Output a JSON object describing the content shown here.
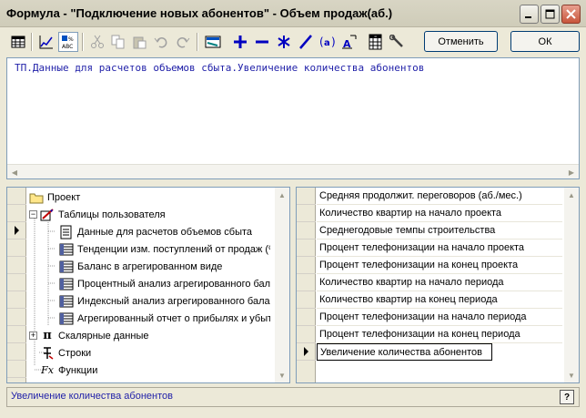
{
  "window": {
    "title": "Формула - \"Подключение новых абонентов\" - Объем продаж(аб.)"
  },
  "toolbar": {
    "cancel_label": "Отменить",
    "ok_label": "ОК",
    "icons": [
      "table-icon",
      "chart-icon",
      "scale-icon",
      "cut-icon",
      "copy-icon",
      "paste-icon",
      "undo-icon",
      "redo-icon",
      "screen-icon",
      "plus-icon",
      "minus-icon",
      "asterisk-icon",
      "slash-icon",
      "a-paren-icon",
      "a-arrow-icon",
      "calendar-icon",
      "wrench-icon"
    ]
  },
  "editor": {
    "formula": "ТП.Данные для расчетов объемов сбыта.Увеличение количества абонентов"
  },
  "tree": {
    "items": [
      {
        "label": "Проект",
        "icon": "folder-icon"
      },
      {
        "label": "Таблицы пользователя",
        "icon": "tables-icon"
      },
      {
        "label": "Данные для расчетов объемов сбыта",
        "icon": "document-icon"
      },
      {
        "label": "Тенденции изм. поступлений от продаж (%",
        "icon": "table-doc-icon"
      },
      {
        "label": "Баланс в агрегированном виде",
        "icon": "table-doc-icon"
      },
      {
        "label": "Процентный анализ агрегированного бала",
        "icon": "table-doc-icon"
      },
      {
        "label": "Индексный анализ агрегированного бала",
        "icon": "table-doc-icon"
      },
      {
        "label": "Агрегированный отчет о прибылях и убытк",
        "icon": "table-doc-icon"
      },
      {
        "label": "Скалярные данные",
        "icon": "pi-icon"
      },
      {
        "label": "Строки",
        "icon": "string-icon"
      },
      {
        "label": "Функции",
        "icon": "function-icon"
      }
    ]
  },
  "list": {
    "items": [
      "Средняя продолжит. переговоров (аб./мес.)",
      "Количество квартир на начало проекта",
      "Среднегодовые темпы строительства",
      "Процент телефонизации на начало проекта",
      "Процент телефонизации на конец проекта",
      "Количество квартир на начало периода",
      "Количество квартир на конец периода",
      "Процент телефонизации на начало периода",
      "Процент телефонизации на конец периода",
      "Увеличение количества абонентов"
    ]
  },
  "status": {
    "text": "Увеличение количества абонентов",
    "help_label": "?"
  },
  "colors": {
    "formula_text": "#1F1FA8",
    "window_bg": "#ECE9D8"
  }
}
